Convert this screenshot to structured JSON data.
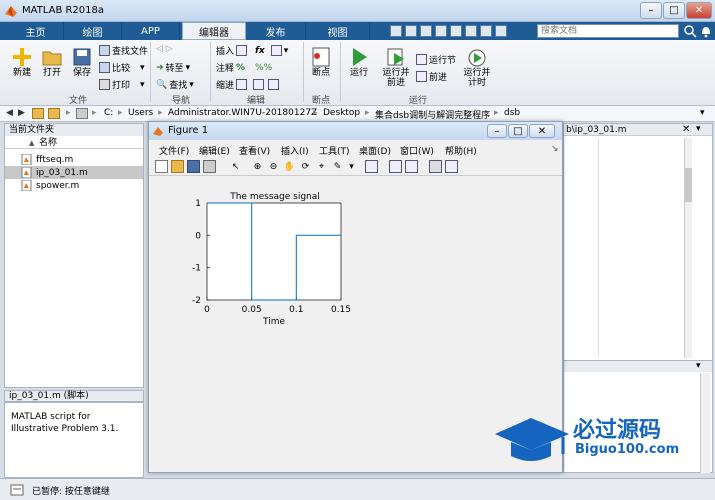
{
  "app": {
    "title": "MATLAB R2018a"
  },
  "tabs": [
    {
      "label": "主页"
    },
    {
      "label": "绘图"
    },
    {
      "label": "APP"
    },
    {
      "label": "编辑器"
    },
    {
      "label": "发布"
    },
    {
      "label": "视图"
    }
  ],
  "search": {
    "placeholder": "搜索文档"
  },
  "ribbon": {
    "file": {
      "new": "新建",
      "open": "打开",
      "save": "保存",
      "find_files": "查找文件",
      "compare": "比较",
      "print": "打印",
      "group": "文件"
    },
    "nav": {
      "goto": "转至",
      "find": "查找",
      "group": "导航"
    },
    "edit": {
      "insert": "插入",
      "comment": "注释",
      "indent": "缩进",
      "fx": "fx",
      "group": "编辑"
    },
    "breakpoints": {
      "label": "断点",
      "group": "断点"
    },
    "run": {
      "run": "运行",
      "run_advance_1": "运行并",
      "run_advance_2": "前进",
      "run_section": "运行节",
      "advance": "前进",
      "run_time_1": "运行并",
      "run_time_2": "计时",
      "group": "运行"
    }
  },
  "address": {
    "path": [
      "C:",
      "Users",
      "Administrator.WIN7U-20180127Z",
      "Desktop",
      "集合dsb调制与解调完整程序",
      "dsb"
    ]
  },
  "left_panel": {
    "title": "当前文件夹",
    "col_name": "名称",
    "sort_arrow": "▲",
    "files": [
      {
        "name": "fftseq.m"
      },
      {
        "name": "ip_03_01.m"
      },
      {
        "name": "spower.m"
      }
    ]
  },
  "detail": {
    "title": "ip_03_01.m  (脚本)",
    "text": "MATLAB script for Illustrative Problem 3.1."
  },
  "right_panel": {
    "tab": "b\\ip_03_01.m"
  },
  "status": {
    "text": "已暂停: 按任意键继"
  },
  "figure": {
    "title": "Figure 1",
    "menu": [
      "文件(F)",
      "编辑(E)",
      "查看(V)",
      "插入(I)",
      "工具(T)",
      "桌面(D)",
      "窗口(W)",
      "帮助(H)"
    ]
  },
  "watermark": {
    "line1": "必过源码",
    "line2": "Biguo100.com"
  },
  "chart_data": {
    "type": "line",
    "title": "The message signal",
    "xlabel": "Time",
    "ylabel": "",
    "xlim": [
      0,
      0.15
    ],
    "ylim": [
      -2,
      1
    ],
    "xticks": [
      "0",
      "0.05",
      "0.1",
      "0.15"
    ],
    "yticks": [
      "1",
      "0",
      "-1",
      "-2"
    ],
    "series": [
      {
        "x": [
          0,
          0.05,
          0.05,
          0.1,
          0.1,
          0.15
        ],
        "y": [
          1,
          1,
          -2,
          -2,
          0,
          0
        ],
        "color": "#0072bd"
      }
    ]
  }
}
